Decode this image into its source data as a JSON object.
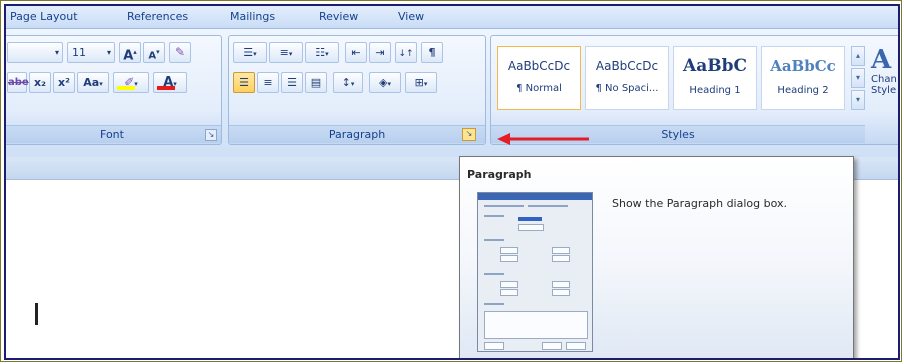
{
  "tabs": [
    "Page Layout",
    "References",
    "Mailings",
    "Review",
    "View"
  ],
  "font_group": {
    "label": "Font",
    "font_size": "11",
    "grow_font": "A",
    "shrink_font": "A",
    "subscript": "x₂",
    "superscript": "x²",
    "change_case": "Aa",
    "font_color": "A",
    "strikethrough": "abe"
  },
  "paragraph_group": {
    "label": "Paragraph"
  },
  "styles_group": {
    "label": "Styles",
    "items": [
      {
        "sample": "AaBbCcDc",
        "name": "¶ Normal"
      },
      {
        "sample": "AaBbCcDc",
        "name": "¶ No Spaci..."
      },
      {
        "sample": "AaBbC",
        "name": "Heading 1"
      },
      {
        "sample": "AaBbCc",
        "name": "Heading 2"
      }
    ],
    "change_styles_line1": "Chan",
    "change_styles_line2": "Style"
  },
  "tooltip": {
    "title": "Paragraph",
    "description": "Show the Paragraph dialog box."
  },
  "colors": {
    "arrow": "#e41e26",
    "highlight": "#ffd46b",
    "font_color_bar": "#e51b1b"
  }
}
